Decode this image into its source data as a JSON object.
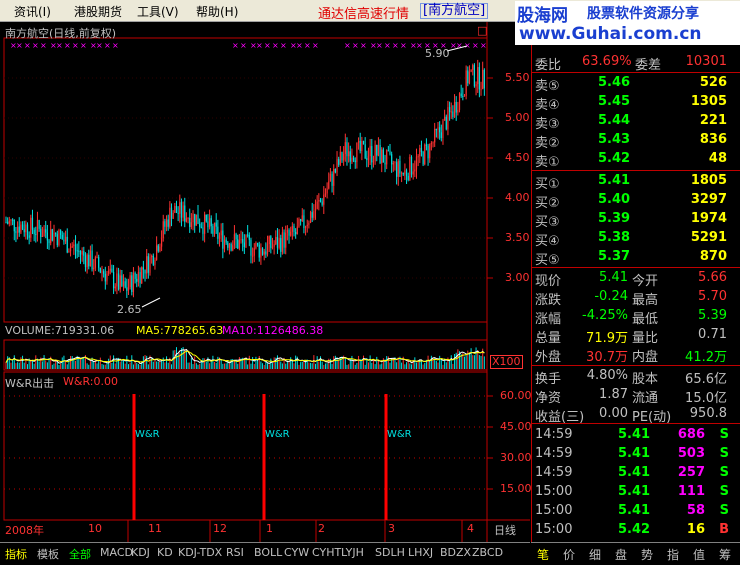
{
  "menu": {
    "items": [
      "资讯(I)",
      "港股期货",
      "工具(V)",
      "帮助(H)"
    ],
    "title": "通达信高速行情",
    "stock": "[南方航空]"
  },
  "brand": {
    "logo": "股海网",
    "slogan": "股票软件资源分享",
    "url": "www.Guhai.com.cn"
  },
  "kchart": {
    "header": "南方航空(日线,前复权)",
    "y_ticks": [
      "5.50",
      "5.00",
      "4.50",
      "4.00",
      "3.50",
      "3.00"
    ],
    "high_label": "5.90",
    "low_label": "2.65",
    "corner": "□"
  },
  "volume": {
    "header_vol": "VOLUME:719331.06",
    "header_ma5": "MA5:778265.63",
    "header_ma10": "MA10:1126486.38",
    "unit": "X100"
  },
  "wr": {
    "name": "W&R出击",
    "value": "W&R:0.00",
    "y_ticks": [
      "60.00",
      "45.00",
      "30.00",
      "15.00"
    ],
    "signal_label": "W&R"
  },
  "xaxis": {
    "labels": [
      "2008年",
      "10",
      "11",
      "12",
      "1",
      "2",
      "3",
      "4"
    ],
    "period": "日线"
  },
  "quote": {
    "wei_bi_label": "委比",
    "wei_bi": "63.69%",
    "wei_cha_label": "委差",
    "wei_cha": "10301",
    "asks": [
      {
        "label": "卖⑤",
        "price": "5.46",
        "vol": "526"
      },
      {
        "label": "卖④",
        "price": "5.45",
        "vol": "1305"
      },
      {
        "label": "卖③",
        "price": "5.44",
        "vol": "221"
      },
      {
        "label": "卖②",
        "price": "5.43",
        "vol": "836"
      },
      {
        "label": "卖①",
        "price": "5.42",
        "vol": "48"
      }
    ],
    "bids": [
      {
        "label": "买①",
        "price": "5.41",
        "vol": "1805"
      },
      {
        "label": "买②",
        "price": "5.40",
        "vol": "3297"
      },
      {
        "label": "买③",
        "price": "5.39",
        "vol": "1974"
      },
      {
        "label": "买④",
        "price": "5.38",
        "vol": "5291"
      },
      {
        "label": "买⑤",
        "price": "5.37",
        "vol": "870"
      }
    ],
    "stats": [
      {
        "l1": "现价",
        "v1": "5.41",
        "l2": "今开",
        "v2": "5.66"
      },
      {
        "l1": "涨跌",
        "v1": "-0.24",
        "l2": "最高",
        "v2": "5.70"
      },
      {
        "l1": "涨幅",
        "v1": "-4.25%",
        "l2": "最低",
        "v2": "5.39"
      },
      {
        "l1": "总量",
        "v1": "71.9万",
        "l2": "量比",
        "v2": "0.71"
      },
      {
        "l1": "外盘",
        "v1": "30.7万",
        "l2": "内盘",
        "v2": "41.2万"
      }
    ],
    "fund": [
      {
        "l1": "换手",
        "v1": "4.80%",
        "l2": "股本",
        "v2": "65.6亿"
      },
      {
        "l1": "净资",
        "v1": "1.87",
        "l2": "流通",
        "v2": "15.0亿"
      },
      {
        "l1": "收益(三)",
        "v1": "0.00",
        "l2": "PE(动)",
        "v2": "950.8"
      }
    ],
    "ticks": [
      {
        "time": "14:59",
        "price": "5.41",
        "vol": "686",
        "side": "S"
      },
      {
        "time": "14:59",
        "price": "5.41",
        "vol": "503",
        "side": "S"
      },
      {
        "time": "14:59",
        "price": "5.41",
        "vol": "257",
        "side": "S"
      },
      {
        "time": "15:00",
        "price": "5.41",
        "vol": "111",
        "side": "S"
      },
      {
        "time": "15:00",
        "price": "5.41",
        "vol": "58",
        "side": "S"
      },
      {
        "time": "15:00",
        "price": "5.42",
        "vol": "16",
        "side": "B"
      }
    ]
  },
  "tabs": [
    "指标",
    "模板",
    "全部",
    "MACD",
    "KDJ",
    "KD",
    "KDJ-TDX",
    "RSI",
    "BOLL",
    "CYW",
    "CYHT",
    "LYJH",
    "SDLH",
    "LHXJ",
    "BDZX",
    "ZBCD"
  ],
  "rtabs": [
    "笔",
    "价",
    "细",
    "盘",
    "势",
    "指",
    "值",
    "筹"
  ],
  "colors": {
    "up": "#ff3232",
    "down": "#00e0e0",
    "grid": "#c00000",
    "yellow": "#ffff00",
    "green": "#00ff00",
    "magenta": "#ff00ff"
  }
}
